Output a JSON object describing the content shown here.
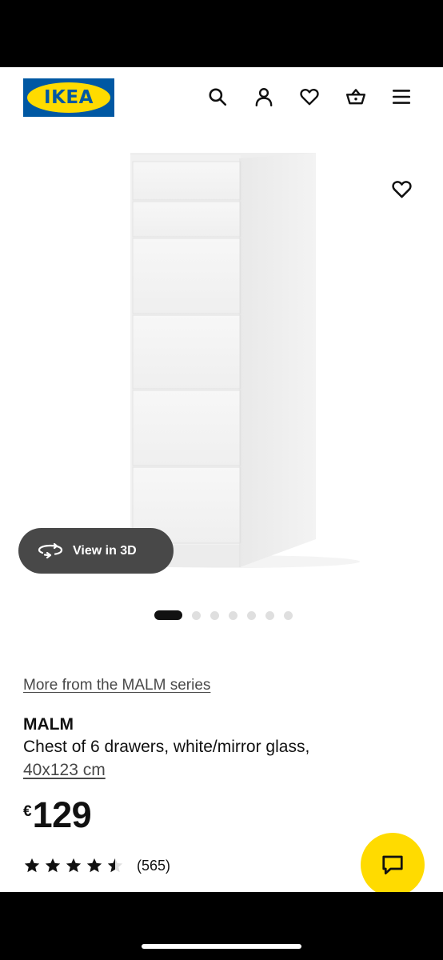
{
  "header": {
    "logo_text": "IKEA",
    "icons": [
      "search-icon",
      "account-icon",
      "favourites-icon",
      "shopping-bag-icon",
      "menu-icon"
    ]
  },
  "gallery": {
    "view_3d_label": "View in 3D",
    "slide_count": 7,
    "active_slide": 1
  },
  "product": {
    "series_link": "More from the MALM series",
    "name": "MALM",
    "description": "Chest of 6 drawers, white/mirror glass,",
    "size": "40x123 cm",
    "price_currency": "€",
    "price_amount": "129",
    "rating": 4.5,
    "review_count": "(565)"
  },
  "colors": {
    "brand_blue": "#0058a3",
    "brand_yellow": "#ffdb00",
    "text": "#111111"
  }
}
